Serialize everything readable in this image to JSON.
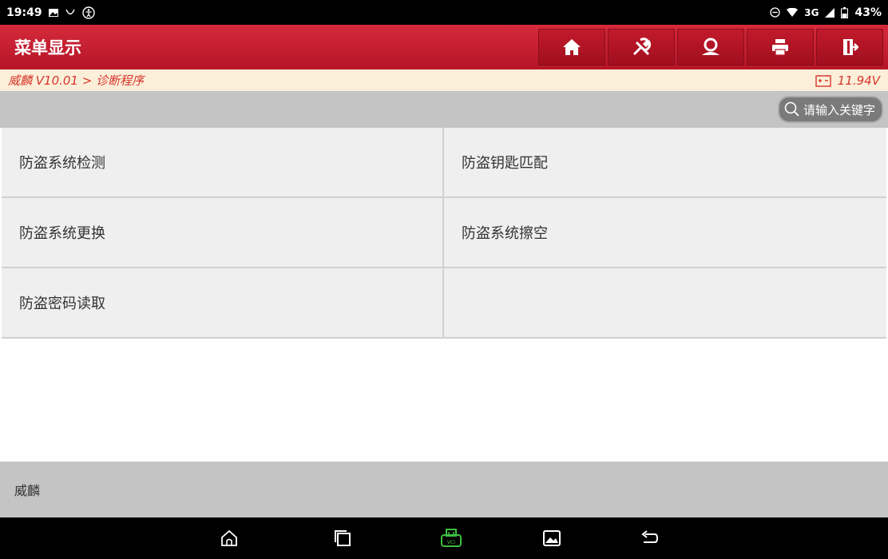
{
  "status_bar": {
    "time": "19:49",
    "network": "3G",
    "battery": "43%"
  },
  "header": {
    "title": "菜单显示",
    "buttons": [
      {
        "name": "home",
        "icon": "home-icon"
      },
      {
        "name": "diagnose",
        "icon": "wrench-icon"
      },
      {
        "name": "user",
        "icon": "user-icon"
      },
      {
        "name": "print",
        "icon": "printer-icon"
      },
      {
        "name": "exit",
        "icon": "exit-icon"
      }
    ]
  },
  "breadcrumb": {
    "path": "威麟 V10.01 > 诊断程序",
    "voltage": "11.94V"
  },
  "search": {
    "placeholder": "请输入关键字"
  },
  "menu": {
    "items": [
      {
        "label": "防盗系统检测"
      },
      {
        "label": "防盗钥匙匹配"
      },
      {
        "label": "防盗系统更换"
      },
      {
        "label": "防盗系统擦空"
      },
      {
        "label": "防盗密码读取"
      },
      {
        "label": ""
      }
    ]
  },
  "footer": {
    "text": "威麟"
  },
  "colors": {
    "accent": "#c8192c",
    "breadcrumb_bg": "#fbefd9",
    "breadcrumb_text": "#d8342c",
    "vci_green": "#3fbf3f"
  }
}
